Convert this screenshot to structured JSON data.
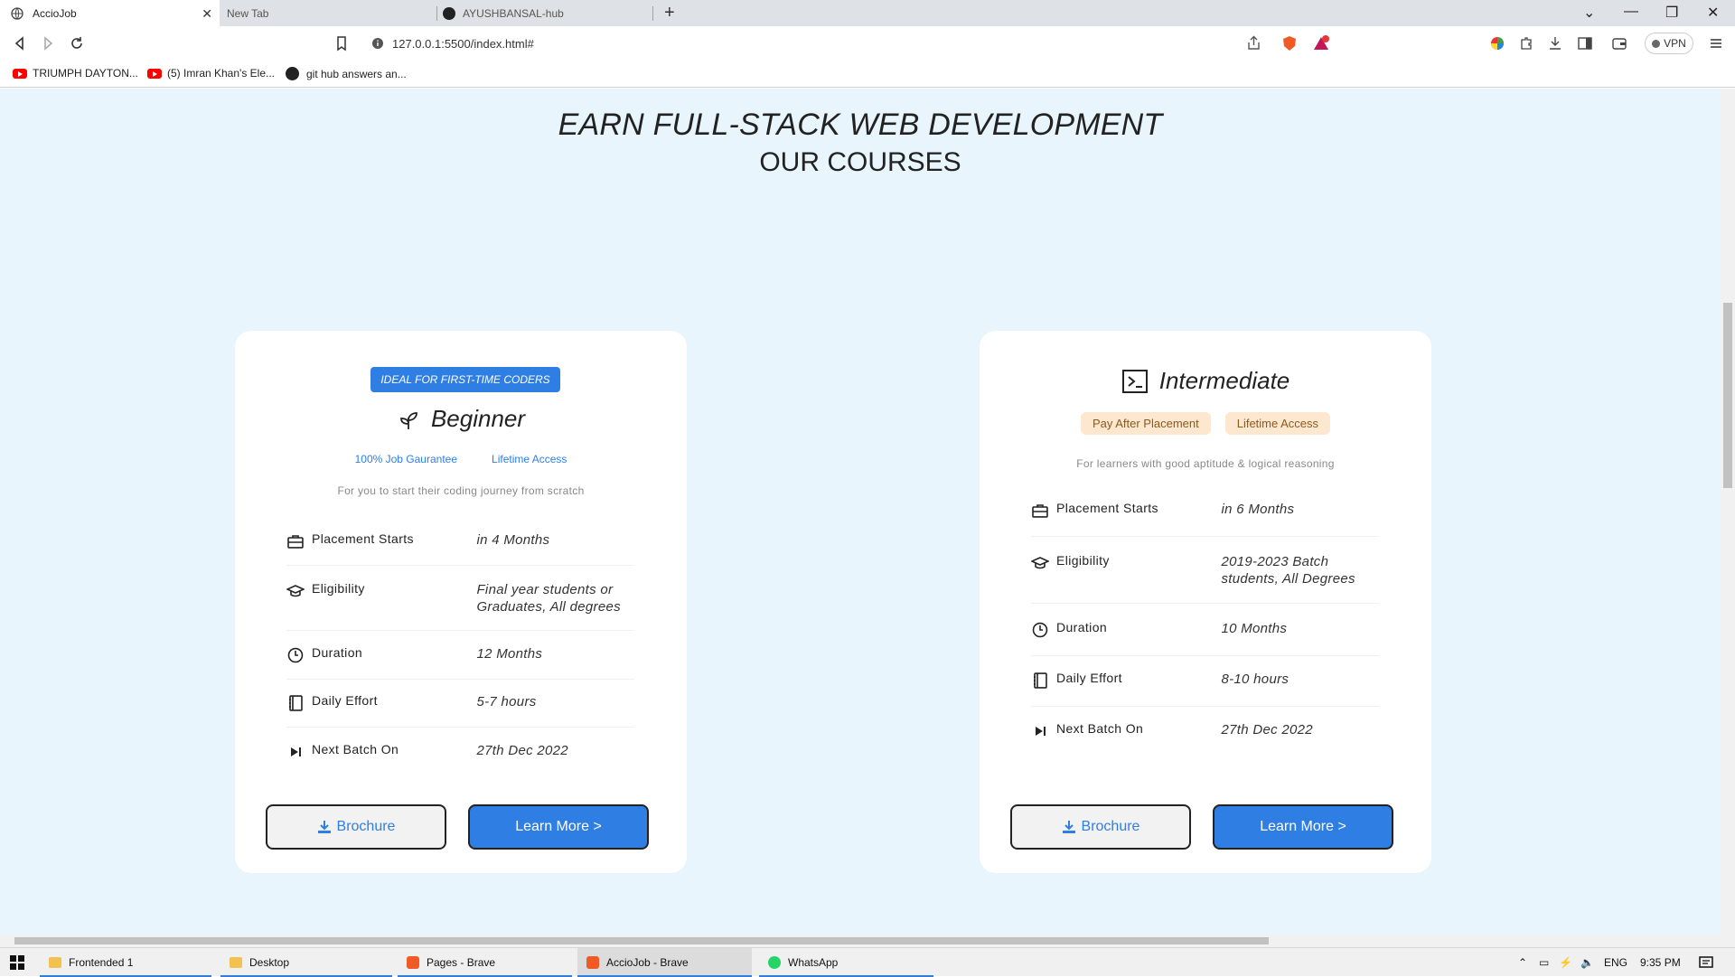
{
  "browser": {
    "tabs": [
      {
        "title": "AccioJob",
        "active": true
      },
      {
        "title": "New Tab",
        "active": false
      },
      {
        "title": "AYUSHBANSAL-hub",
        "active": false
      }
    ],
    "url": "127.0.0.1:5500/index.html#",
    "vpn_label": "VPN",
    "bookmarks": [
      "TRIUMPH DAYTON...",
      "(5) Imran Khan's Ele...",
      "git hub answers an..."
    ]
  },
  "page": {
    "heading": "EARN FULL-STACK WEB DEVELOPMENT",
    "subheading": "OUR COURSES",
    "cards": [
      {
        "badge": "IDEAL FOR FIRST-TIME CODERS",
        "title": "Beginner",
        "perks": [
          "100% Job Gaurantee",
          "Lifetime Access"
        ],
        "description": "For you to start their coding journey from scratch",
        "rows": [
          {
            "icon": "briefcase-icon",
            "label": "Placement Starts",
            "value": "in 4 Months"
          },
          {
            "icon": "graduation-cap-icon",
            "label": "Eligibility",
            "value": "Final year students or Graduates, All degrees"
          },
          {
            "icon": "clock-icon",
            "label": "Duration",
            "value": "12 Months"
          },
          {
            "icon": "notebook-icon",
            "label": "Daily Effort",
            "value": "5-7 hours"
          },
          {
            "icon": "skip-forward-icon",
            "label": "Next Batch On",
            "value": "27th Dec 2022"
          }
        ],
        "brochure_label": "Brochure",
        "learn_more_label": "Learn More >"
      },
      {
        "title": "Intermediate",
        "pills": [
          "Pay After Placement",
          "Lifetime Access"
        ],
        "description": "For learners with good aptitude & logical reasoning",
        "rows": [
          {
            "icon": "briefcase-icon",
            "label": "Placement Starts",
            "value": "in 6 Months"
          },
          {
            "icon": "graduation-cap-icon",
            "label": "Eligibility",
            "value": "2019-2023 Batch students, All Degrees"
          },
          {
            "icon": "clock-icon",
            "label": "Duration",
            "value": "10 Months"
          },
          {
            "icon": "notebook-icon",
            "label": "Daily Effort",
            "value": "8-10 hours"
          },
          {
            "icon": "skip-forward-icon",
            "label": "Next Batch On",
            "value": "27th Dec 2022"
          }
        ],
        "brochure_label": "Brochure",
        "learn_more_label": "Learn More >"
      }
    ]
  },
  "taskbar": {
    "items": [
      "Frontended 1",
      "Desktop",
      "Pages - Brave",
      "AccioJob - Brave",
      "WhatsApp"
    ],
    "language": "ENG",
    "time": "9:35 PM"
  }
}
